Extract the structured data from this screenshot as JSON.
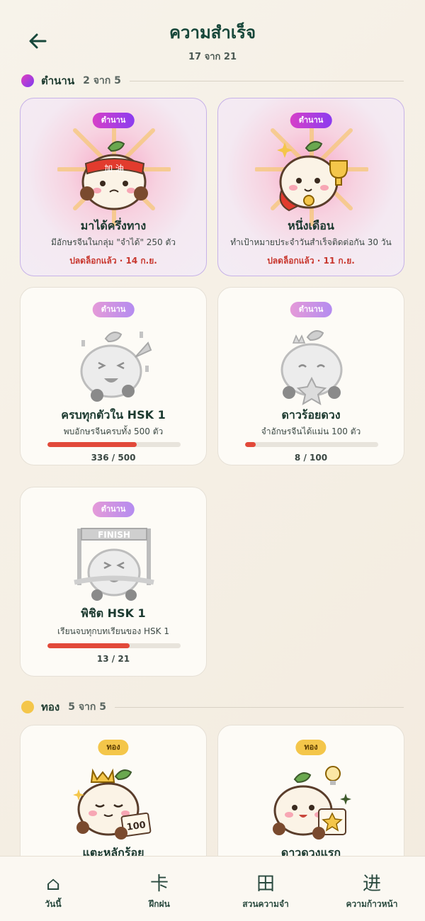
{
  "header": {
    "title": "ความสำเร็จ",
    "subtitle": "17 จาก 21"
  },
  "sections": [
    {
      "name": "ตำนาน",
      "count": "2 จาก 5",
      "color": "#b43ee0",
      "cards": [
        {
          "badge": "ตำนาน",
          "title": "มาได้ครึ่งทาง",
          "desc": "มีอักษรจีนในกลุ่ม \"จำได้\" 250 ตัว",
          "unlocked": "ปลดล็อกแล้ว · 14 ก.ย."
        },
        {
          "badge": "ตำนาน",
          "title": "หนึ่งเดือน",
          "desc": "ทำเป้าหมายประจำวันสำเร็จติดต่อกัน 30 วัน",
          "unlocked": "ปลดล็อกแล้ว · 11 ก.ย."
        },
        {
          "badge": "ตำนาน",
          "title": "ครบทุกตัวใน HSK 1",
          "desc": "พบอักษรจีนครบทั้ง 500 ตัว",
          "progress_text": "336 / 500",
          "progress": 0.672
        },
        {
          "badge": "ตำนาน",
          "title": "ดาวร้อยดวง",
          "desc": "จำอักษรจีนได้แม่น 100 ตัว",
          "progress_text": "8 / 100",
          "progress": 0.08
        },
        {
          "badge": "ตำนาน",
          "title": "พิชิต HSK 1",
          "desc": "เรียนจบทุกบทเรียนของ HSK 1",
          "progress_text": "13 / 21",
          "progress": 0.619,
          "art_text": "FINISH"
        }
      ]
    },
    {
      "name": "ทอง",
      "count": "5 จาก 5",
      "color": "#f4c64a",
      "cards": [
        {
          "badge": "ทอง",
          "title": "แตะหลักร้อย",
          "art_text": "100"
        },
        {
          "badge": "ทอง",
          "title": "ดาวดวงแรก"
        }
      ]
    }
  ],
  "art_labels": {
    "headband": "加 油"
  },
  "nav": [
    {
      "icon": "⌂",
      "label": "วันนี้"
    },
    {
      "icon": "卡",
      "label": "ฝึกฝน"
    },
    {
      "icon": "田",
      "label": "สวนความจำ"
    },
    {
      "icon": "进",
      "label": "ความก้าวหน้า"
    }
  ]
}
